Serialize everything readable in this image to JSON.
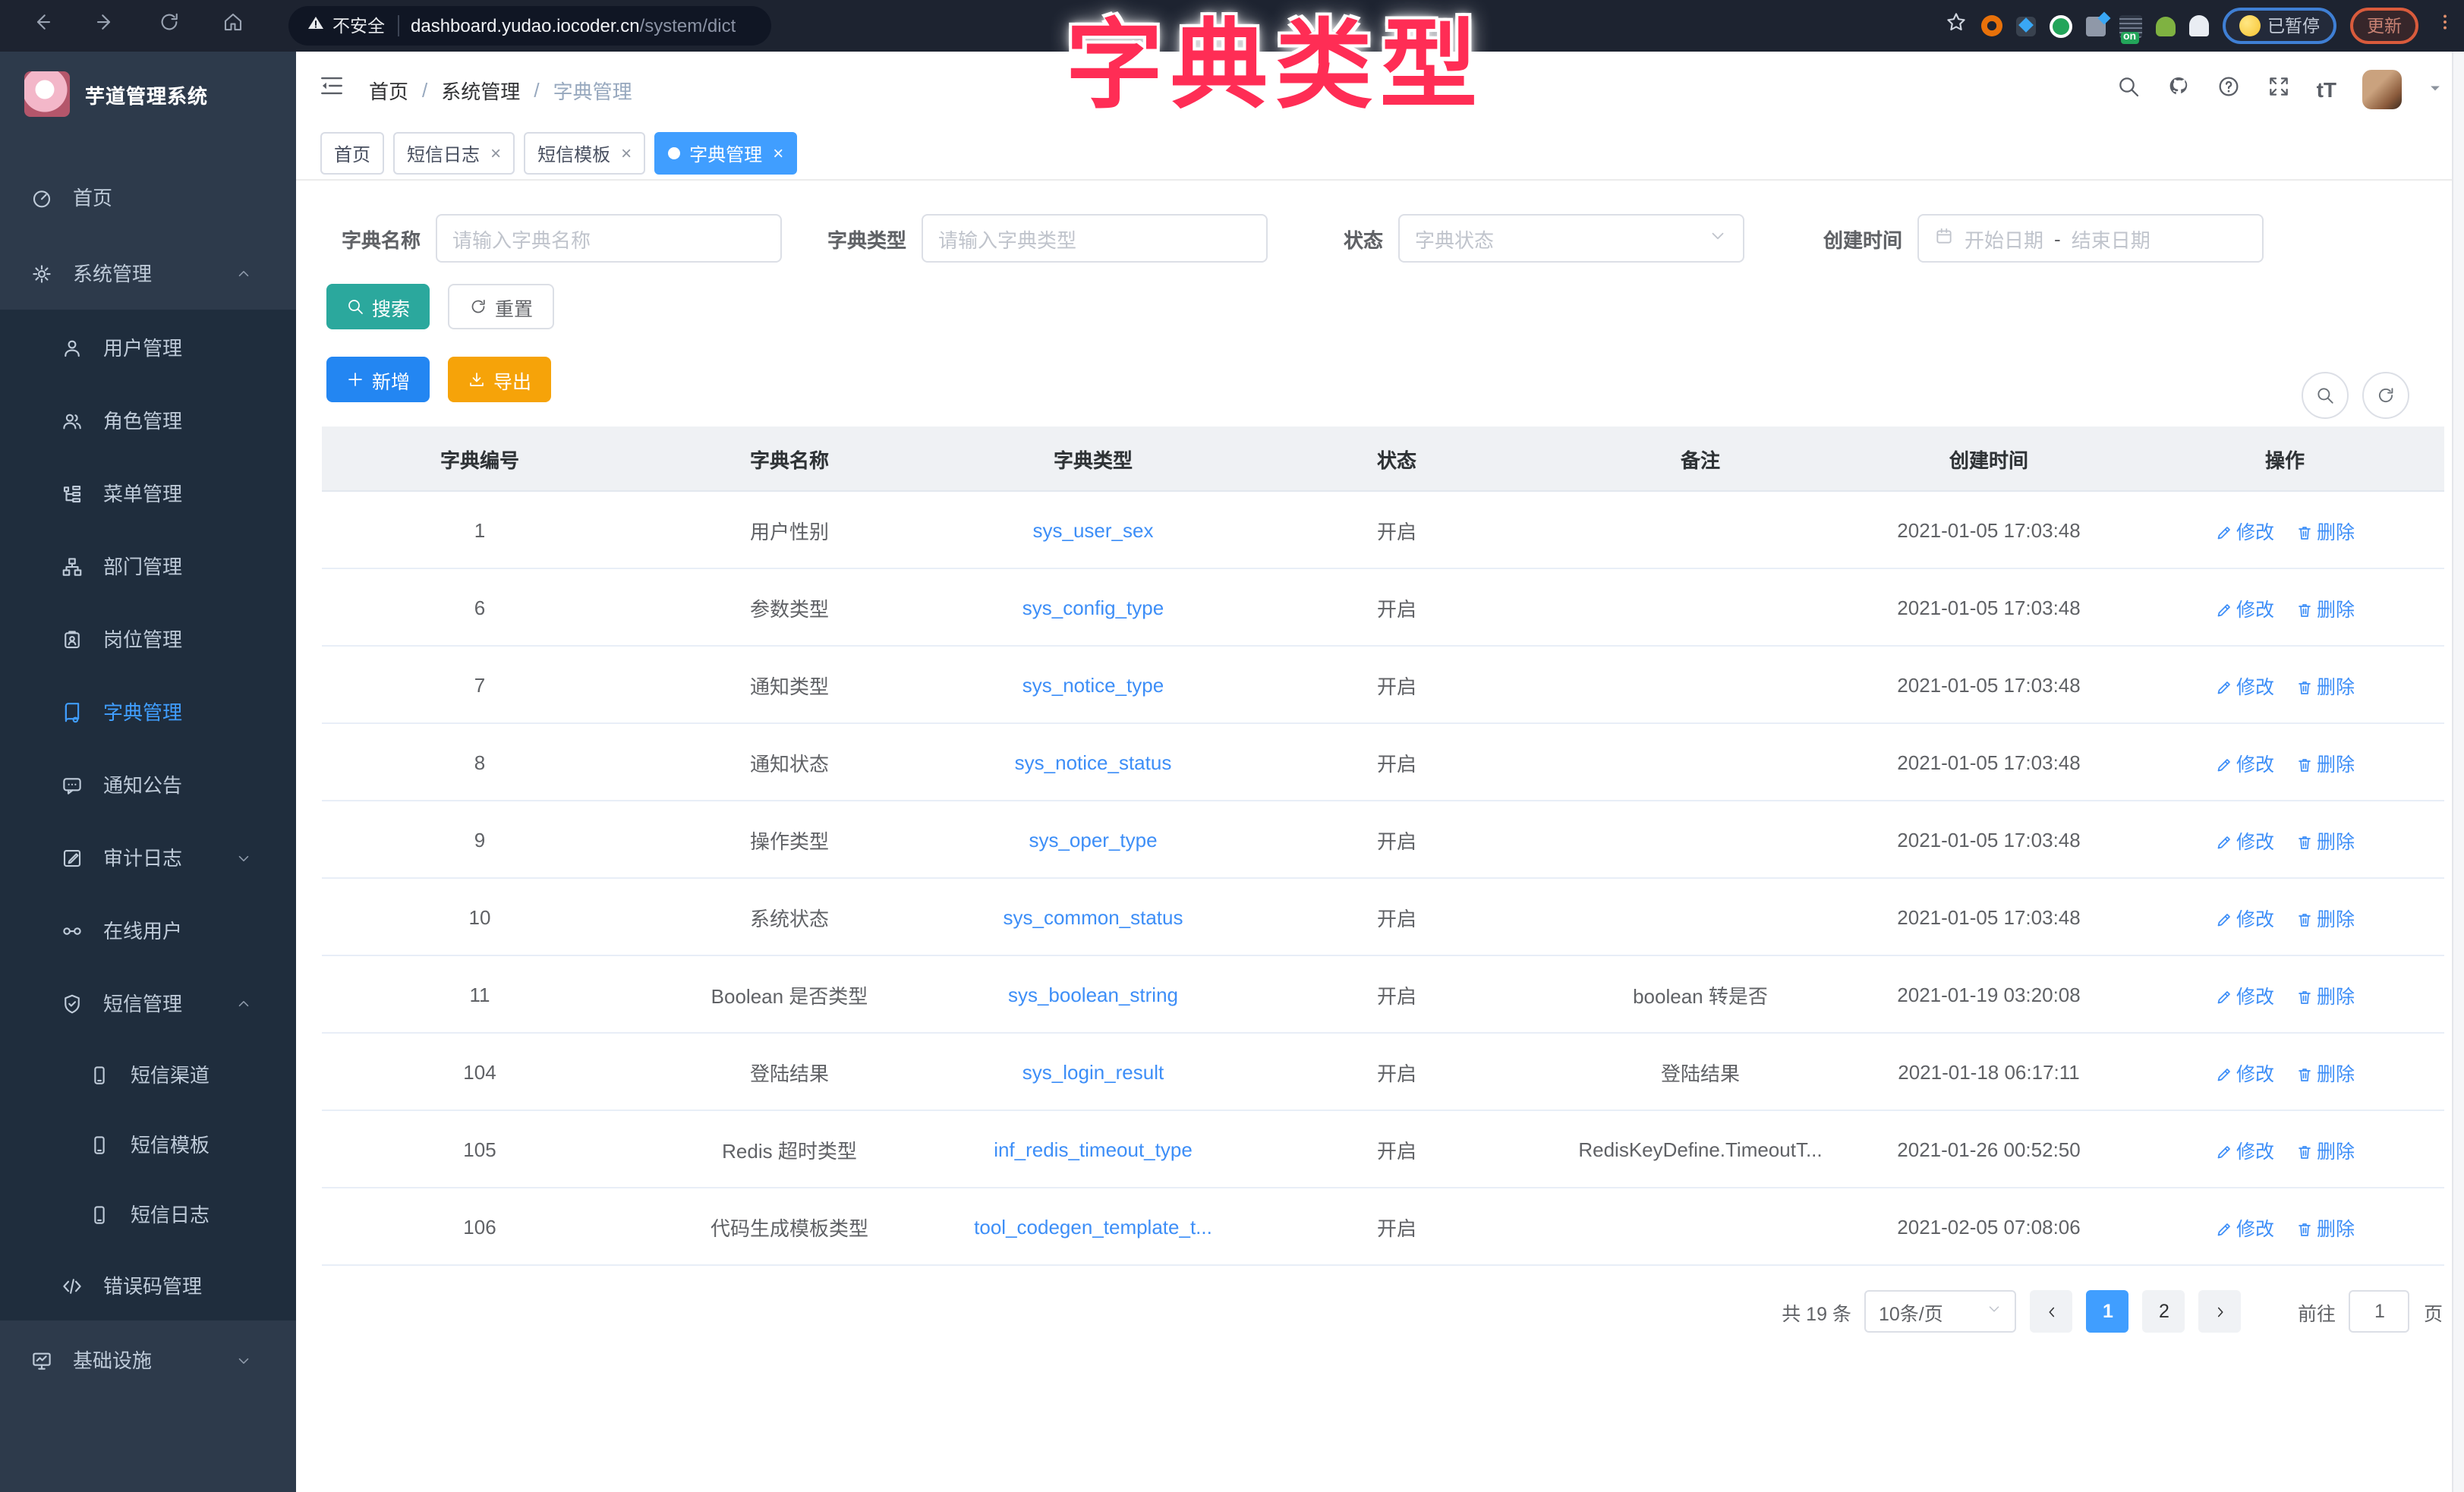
{
  "browser": {
    "security_label": "不安全",
    "url_domain": "dashboard.yudao.iocoder.cn",
    "url_path": "/system/dict",
    "paused_badge": "已暂停",
    "update_button": "更新"
  },
  "overlay_title": {
    "text": "字典类型",
    "color": "#ff2d55"
  },
  "sidebar": {
    "app_title": "芋道管理系统",
    "menu": [
      {
        "label": "首页",
        "icon": "dashboard",
        "level": 1
      },
      {
        "label": "系统管理",
        "icon": "gear",
        "level": 1,
        "chevron": "up"
      },
      {
        "label": "用户管理",
        "icon": "user",
        "level": 2
      },
      {
        "label": "角色管理",
        "icon": "users",
        "level": 2
      },
      {
        "label": "菜单管理",
        "icon": "tree",
        "level": 2
      },
      {
        "label": "部门管理",
        "icon": "org",
        "level": 2
      },
      {
        "label": "岗位管理",
        "icon": "badge",
        "level": 2
      },
      {
        "label": "字典管理",
        "icon": "book",
        "level": 2,
        "active": true
      },
      {
        "label": "通知公告",
        "icon": "message",
        "level": 2
      },
      {
        "label": "审计日志",
        "icon": "log",
        "level": 2,
        "chevron": "down"
      },
      {
        "label": "在线用户",
        "icon": "link",
        "level": 2
      },
      {
        "label": "短信管理",
        "icon": "shield",
        "level": 2,
        "chevron": "up"
      },
      {
        "label": "短信渠道",
        "icon": "phone",
        "level": 3
      },
      {
        "label": "短信模板",
        "icon": "phone",
        "level": 3
      },
      {
        "label": "短信日志",
        "icon": "phone",
        "level": 3
      },
      {
        "label": "错误码管理",
        "icon": "code",
        "level": 2
      },
      {
        "label": "基础设施",
        "icon": "monitor",
        "level": 1,
        "chevron": "down"
      }
    ]
  },
  "navbar": {
    "breadcrumb": [
      "首页",
      "系统管理",
      "字典管理"
    ]
  },
  "tabs": [
    {
      "label": "首页",
      "closable": false,
      "active": false
    },
    {
      "label": "短信日志",
      "closable": true,
      "active": false
    },
    {
      "label": "短信模板",
      "closable": true,
      "active": false
    },
    {
      "label": "字典管理",
      "closable": true,
      "active": true
    }
  ],
  "filters": {
    "name_label": "字典名称",
    "name_placeholder": "请输入字典名称",
    "type_label": "字典类型",
    "type_placeholder": "请输入字典类型",
    "status_label": "状态",
    "status_placeholder": "字典状态",
    "date_label": "创建时间",
    "date_start_placeholder": "开始日期",
    "date_separator": "-",
    "date_end_placeholder": "结束日期",
    "search_label": "搜索",
    "reset_label": "重置"
  },
  "toolbar": {
    "add_label": "新增",
    "export_label": "导出"
  },
  "table": {
    "columns": [
      "字典编号",
      "字典名称",
      "字典类型",
      "状态",
      "备注",
      "创建时间",
      "操作"
    ],
    "edit_label": "修改",
    "delete_label": "删除",
    "rows": [
      {
        "id": "1",
        "name": "用户性别",
        "type": "sys_user_sex",
        "status": "开启",
        "remark": "",
        "created": "2021-01-05 17:03:48"
      },
      {
        "id": "6",
        "name": "参数类型",
        "type": "sys_config_type",
        "status": "开启",
        "remark": "",
        "created": "2021-01-05 17:03:48"
      },
      {
        "id": "7",
        "name": "通知类型",
        "type": "sys_notice_type",
        "status": "开启",
        "remark": "",
        "created": "2021-01-05 17:03:48"
      },
      {
        "id": "8",
        "name": "通知状态",
        "type": "sys_notice_status",
        "status": "开启",
        "remark": "",
        "created": "2021-01-05 17:03:48"
      },
      {
        "id": "9",
        "name": "操作类型",
        "type": "sys_oper_type",
        "status": "开启",
        "remark": "",
        "created": "2021-01-05 17:03:48"
      },
      {
        "id": "10",
        "name": "系统状态",
        "type": "sys_common_status",
        "status": "开启",
        "remark": "",
        "created": "2021-01-05 17:03:48"
      },
      {
        "id": "11",
        "name": "Boolean 是否类型",
        "type": "sys_boolean_string",
        "status": "开启",
        "remark": "boolean 转是否",
        "created": "2021-01-19 03:20:08"
      },
      {
        "id": "104",
        "name": "登陆结果",
        "type": "sys_login_result",
        "status": "开启",
        "remark": "登陆结果",
        "created": "2021-01-18 06:17:11"
      },
      {
        "id": "105",
        "name": "Redis 超时类型",
        "type": "inf_redis_timeout_type",
        "status": "开启",
        "remark": "RedisKeyDefine.TimeoutT...",
        "created": "2021-01-26 00:52:50"
      },
      {
        "id": "106",
        "name": "代码生成模板类型",
        "type": "tool_codegen_template_t...",
        "status": "开启",
        "remark": "",
        "created": "2021-02-05 07:08:06"
      }
    ]
  },
  "pagination": {
    "total_label": "共 19 条",
    "page_size": "10条/页",
    "pages": [
      "1",
      "2"
    ],
    "active_page": "1",
    "goto_label": "前往",
    "goto_value": "1",
    "page_unit": "页"
  },
  "colors": {
    "accent_blue": "#409eff",
    "button_search": "#2ba89d",
    "button_add": "#2386f2",
    "button_export": "#f6a309",
    "sidebar_bg": "#2d3a4b",
    "submenu_bg": "#1f2d3d",
    "browser_bg": "#1d2330",
    "overlay_pink": "#ff2d55",
    "link_blue": "#3d8ef7"
  }
}
